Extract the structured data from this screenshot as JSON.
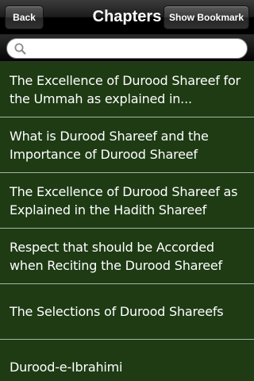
{
  "navbar": {
    "back_label": "Back",
    "title": "Chapters",
    "bookmark_label": "Show Bookmark"
  },
  "search": {
    "value": "",
    "placeholder": ""
  },
  "chapters": [
    "The Excellence of Durood Shareef for the Ummah as explained in...",
    "What is Durood Shareef and the Importance of Durood Shareef",
    "The Excellence of Durood Shareef as Explained in the Hadith Shareef",
    "Respect that should be Accorded when Reciting the Durood Shareef",
    "The Selections of Durood Shareefs",
    "Durood-e-Ibrahimi"
  ],
  "colors": {
    "list_background": "#1e3b14",
    "separator": "#a9b5a4",
    "navbar": "#000000"
  }
}
